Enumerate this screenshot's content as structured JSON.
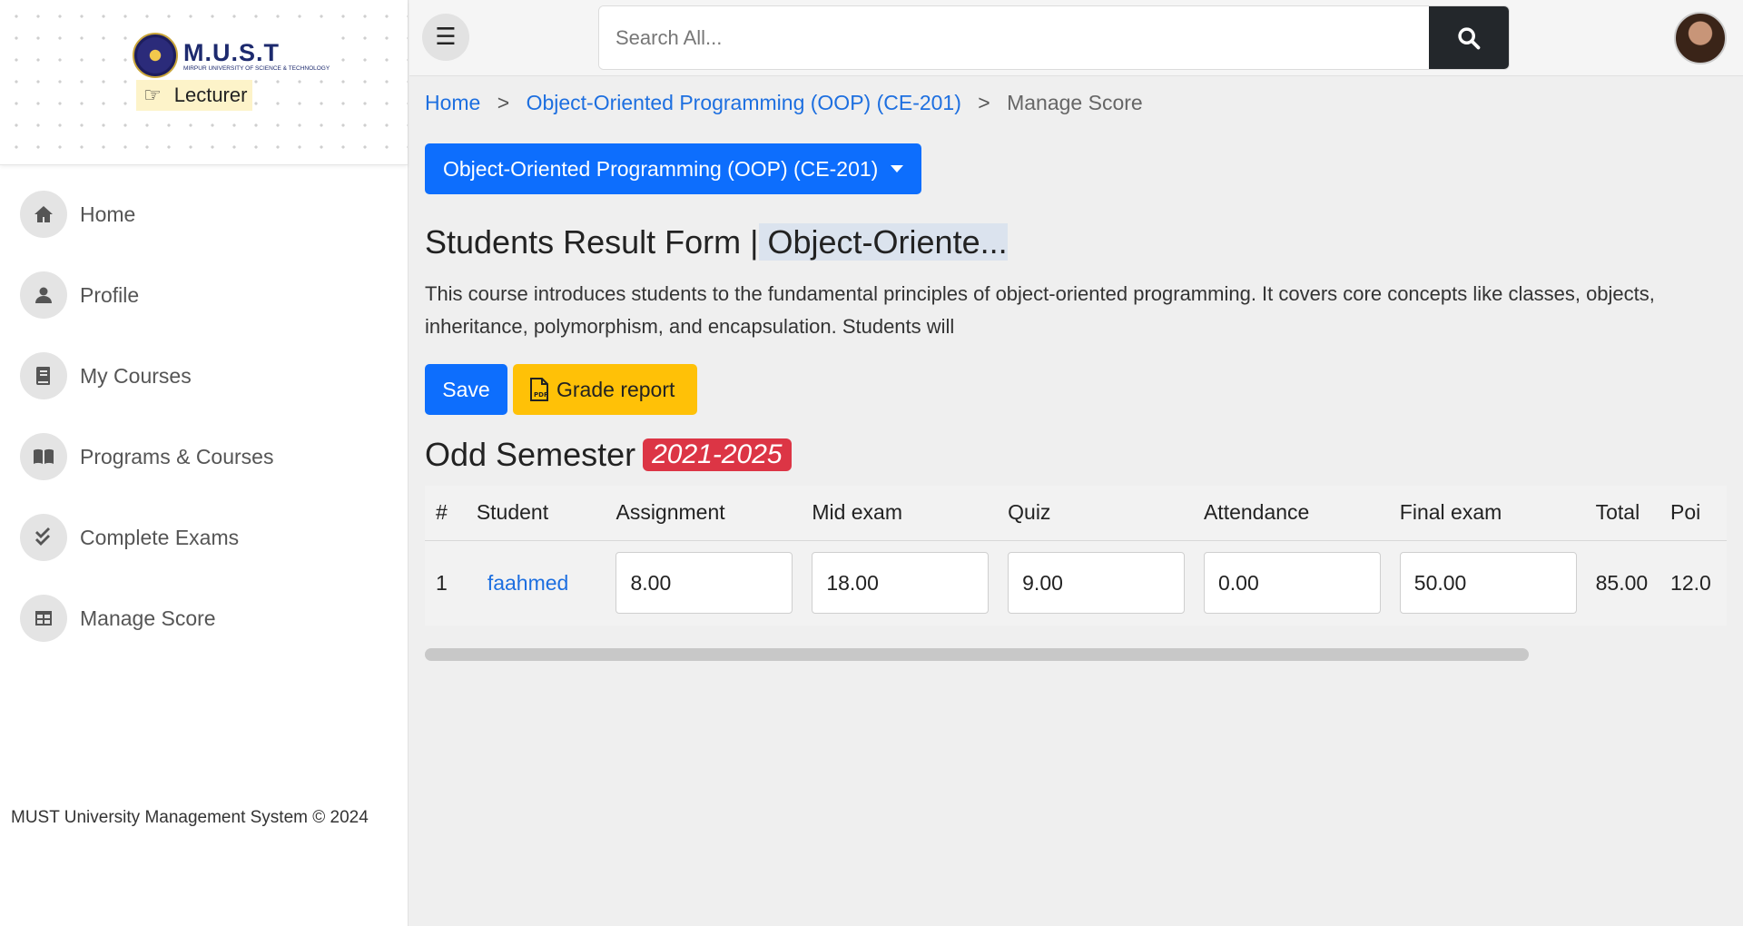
{
  "sidebar": {
    "logo": {
      "title": "M.U.S.T",
      "subtitle": "MIRPUR UNIVERSITY OF SCIENCE & TECHNOLOGY"
    },
    "role": "Lecturer",
    "items": [
      {
        "label": "Home",
        "icon": "home-icon"
      },
      {
        "label": "Profile",
        "icon": "user-icon"
      },
      {
        "label": "My Courses",
        "icon": "book-icon"
      },
      {
        "label": "Programs & Courses",
        "icon": "open-book-icon"
      },
      {
        "label": "Complete Exams",
        "icon": "check-double-icon"
      },
      {
        "label": "Manage Score",
        "icon": "table-icon"
      }
    ],
    "footer": "MUST University Management System © 2024"
  },
  "topbar": {
    "search_placeholder": "Search All..."
  },
  "breadcrumb": {
    "home": "Home",
    "course": "Object-Oriented Programming (OOP) (CE-201)",
    "current": "Manage Score",
    "separator": ">"
  },
  "course_dropdown": {
    "label": "Object-Oriented Programming (OOP) (CE-201)"
  },
  "page": {
    "title_prefix": "Students Result Form |",
    "title_course": " Object-Oriente...",
    "description": "This course introduces students to the fundamental principles of object-oriented programming. It covers core concepts like classes, objects, inheritance, polymorphism, and encapsulation. Students will"
  },
  "actions": {
    "save": "Save",
    "grade_report": "Grade report"
  },
  "semester": {
    "title": "Odd Semester",
    "year": "2021-2025"
  },
  "table": {
    "headers": [
      "#",
      "Student",
      "Assignment",
      "Mid exam",
      "Quiz",
      "Attendance",
      "Final exam",
      "Total",
      "Poi"
    ],
    "rows": [
      {
        "num": "1",
        "student": "faahmed",
        "assignment": "8.00",
        "mid_exam": "18.00",
        "quiz": "9.00",
        "attendance": "0.00",
        "final_exam": "50.00",
        "total": "85.00",
        "point": "12.0"
      }
    ]
  },
  "colors": {
    "primary": "#0d6efd",
    "warning": "#ffc107",
    "danger": "#dc3545",
    "dark": "#23272b"
  }
}
